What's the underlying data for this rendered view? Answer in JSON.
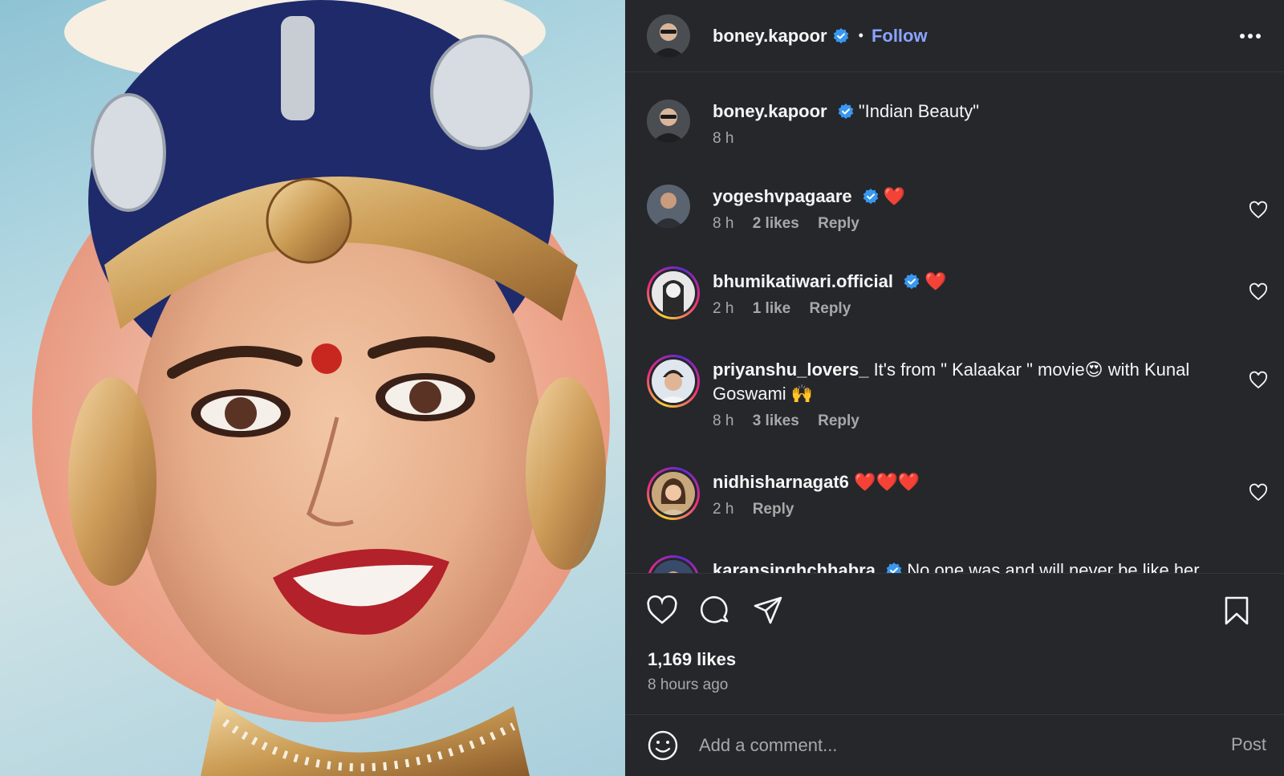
{
  "post": {
    "author": "boney.kapoor",
    "follow_label": "Follow",
    "separator": "•",
    "verified_color": "#3897f0",
    "accent_color": "#8aa4ff"
  },
  "comments": [
    {
      "user": "boney.kapoor",
      "verified": true,
      "text": "\"Indian Beauty\"",
      "time": "8 h",
      "likes": "",
      "reply": ""
    },
    {
      "user": "yogeshvpagaare",
      "verified": true,
      "text": "❤️",
      "time": "8 h",
      "likes": "2 likes",
      "reply": "Reply"
    },
    {
      "user": "bhumikatiwari.official",
      "verified": true,
      "text": "❤️",
      "time": "2 h",
      "likes": "1 like",
      "reply": "Reply"
    },
    {
      "user": "priyanshu_lovers_",
      "verified": false,
      "text": "It's from \" Kalaakar \" movie😍 with Kunal Goswami 🙌",
      "time": "8 h",
      "likes": "3 likes",
      "reply": "Reply"
    },
    {
      "user": "nidhisharnagat6",
      "verified": false,
      "text": "❤️❤️❤️",
      "time": "2 h",
      "likes": "",
      "reply": "Reply"
    },
    {
      "user": "karansinghchhabra",
      "verified": true,
      "text": "No one was and will never be like her",
      "time": "",
      "likes": "",
      "reply": ""
    }
  ],
  "footer": {
    "likes": "1,169 likes",
    "time_ago": "8 hours ago",
    "comment_placeholder": "Add a comment...",
    "post_label": "Post"
  },
  "icons": {
    "like": "heart-icon",
    "comment": "comment-icon",
    "share": "send-icon",
    "save": "bookmark-icon",
    "more": "more-icon",
    "emoji": "emoji-icon"
  }
}
